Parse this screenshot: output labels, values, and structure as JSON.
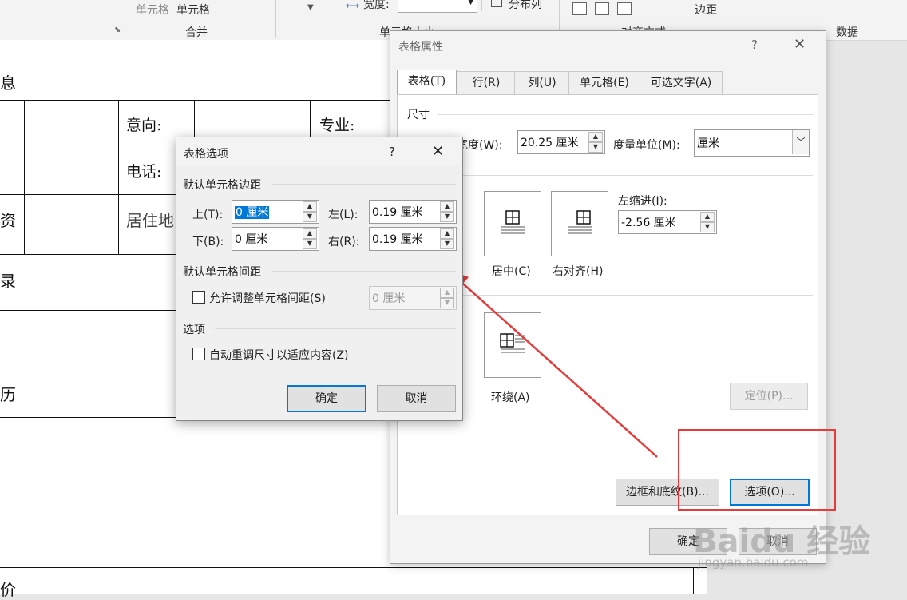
{
  "ribbon": {
    "cell_label1": "单元格",
    "cell_label2": "单元格",
    "merge_group": "合并",
    "width_label": "宽度:",
    "distribute_cols": "分布列",
    "cell_size_group": "单元格大小",
    "alignment_group": "对齐方式",
    "margins": "边距",
    "data_group": "数据"
  },
  "document": {
    "row1": "息",
    "intention": "意向:",
    "major": "专业:",
    "phone": "电话:",
    "row3_left": "资",
    "residence": "居住地",
    "row4": "录",
    "row6": "历",
    "bottom": "价"
  },
  "table_properties": {
    "title": "表格属性",
    "help": "?",
    "tabs": [
      "表格(T)",
      "行(R)",
      "列(U)",
      "单元格(E)",
      "可选文字(A)"
    ],
    "size_group": "尺寸",
    "width_label": "宽度(W):",
    "width_value": "20.25 厘米",
    "measure_label": "度量单位(M):",
    "measure_value": "厘米",
    "align_left_partial": "L)",
    "align_center": "居中(C)",
    "align_right": "右对齐(H)",
    "indent_label": "左缩进(I):",
    "indent_value": "-2.56 厘米",
    "wrap_around": "环绕(A)",
    "positioning": "定位(P)...",
    "borders_shading": "边框和底纹(B)...",
    "options": "选项(O)...",
    "ok": "确定",
    "cancel_partial": "取消"
  },
  "table_options": {
    "title": "表格选项",
    "help": "?",
    "default_margins": "默认单元格边距",
    "top_label": "上(T):",
    "top_value": "0 厘米",
    "left_label": "左(L):",
    "left_value": "0.19 厘米",
    "bottom_label": "下(B):",
    "bottom_value": "0 厘米",
    "right_label": "右(R):",
    "right_value": "0.19 厘米",
    "default_spacing": "默认单元格间距",
    "allow_spacing": "允许调整单元格间距(S)",
    "spacing_value": "0 厘米",
    "options_group": "选项",
    "auto_resize": "自动重调尺寸以适应内容(Z)",
    "ok": "确定",
    "cancel": "取消"
  },
  "watermark": {
    "brand": "Baidu 经验",
    "url": "jingyan.baidu.com"
  },
  "colors": {
    "annotation_red": "#e53b3b",
    "accent_blue": "#0078d7"
  }
}
